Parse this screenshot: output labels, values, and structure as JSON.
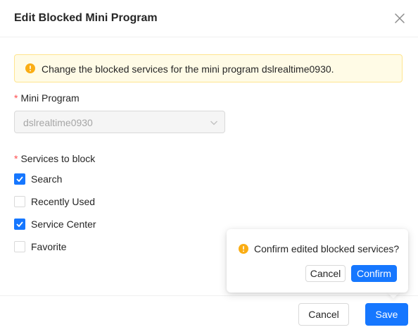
{
  "dialog": {
    "title": "Edit Blocked Mini Program",
    "close_icon": "close-icon"
  },
  "alert": {
    "icon": "warning-circle-icon",
    "color": "#faad14",
    "text": "Change the blocked services for the mini program dslrealtime0930."
  },
  "form": {
    "required_mark": "*",
    "mini_program": {
      "label": "Mini Program",
      "value": "dslrealtime0930",
      "disabled": true
    },
    "services": {
      "label": "Services to block",
      "options": [
        {
          "label": "Search",
          "checked": true
        },
        {
          "label": "Recently Used",
          "checked": false
        },
        {
          "label": "Service Center",
          "checked": true
        },
        {
          "label": "Favorite",
          "checked": false
        }
      ]
    }
  },
  "footer": {
    "cancel_label": "Cancel",
    "save_label": "Save"
  },
  "popconfirm": {
    "icon": "warning-circle-icon",
    "message": "Confirm edited blocked services?",
    "cancel_label": "Cancel",
    "confirm_label": "Confirm"
  },
  "colors": {
    "primary": "#1677ff",
    "warning": "#faad14",
    "required": "#ff4d4f"
  }
}
